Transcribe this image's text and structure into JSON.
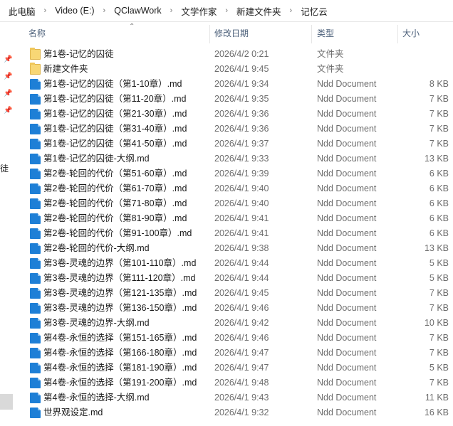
{
  "breadcrumb": {
    "items": [
      "此电脑",
      "Video (E:)",
      "QClawWork",
      "文学作家",
      "新建文件夹",
      "记忆云"
    ],
    "separator": "›"
  },
  "columns": {
    "name": "名称",
    "date": "修改日期",
    "type": "类型",
    "size": "大小"
  },
  "left_panel_cutoff_text": "徒",
  "colors": {
    "file_icon": "#1e7fd6",
    "folder_icon": "#f8d775",
    "header_text": "#4c607a"
  },
  "files": [
    {
      "name": "第1卷-记忆的囚徒",
      "date": "2026/4/2 0:21",
      "type": "文件夹",
      "size": "",
      "kind": "folder"
    },
    {
      "name": "新建文件夹",
      "date": "2026/4/1 9:45",
      "type": "文件夹",
      "size": "",
      "kind": "folder"
    },
    {
      "name": "第1卷-记忆的囚徒（第1-10章）.md",
      "date": "2026/4/1 9:34",
      "type": "Ndd Document",
      "size": "8 KB",
      "kind": "file"
    },
    {
      "name": "第1卷-记忆的囚徒（第11-20章）.md",
      "date": "2026/4/1 9:35",
      "type": "Ndd Document",
      "size": "7 KB",
      "kind": "file"
    },
    {
      "name": "第1卷-记忆的囚徒（第21-30章）.md",
      "date": "2026/4/1 9:36",
      "type": "Ndd Document",
      "size": "7 KB",
      "kind": "file"
    },
    {
      "name": "第1卷-记忆的囚徒（第31-40章）.md",
      "date": "2026/4/1 9:36",
      "type": "Ndd Document",
      "size": "7 KB",
      "kind": "file"
    },
    {
      "name": "第1卷-记忆的囚徒（第41-50章）.md",
      "date": "2026/4/1 9:37",
      "type": "Ndd Document",
      "size": "7 KB",
      "kind": "file"
    },
    {
      "name": "第1卷-记忆的囚徒-大纲.md",
      "date": "2026/4/1 9:33",
      "type": "Ndd Document",
      "size": "13 KB",
      "kind": "file"
    },
    {
      "name": "第2卷-轮回的代价（第51-60章）.md",
      "date": "2026/4/1 9:39",
      "type": "Ndd Document",
      "size": "6 KB",
      "kind": "file"
    },
    {
      "name": "第2卷-轮回的代价（第61-70章）.md",
      "date": "2026/4/1 9:40",
      "type": "Ndd Document",
      "size": "6 KB",
      "kind": "file"
    },
    {
      "name": "第2卷-轮回的代价（第71-80章）.md",
      "date": "2026/4/1 9:40",
      "type": "Ndd Document",
      "size": "6 KB",
      "kind": "file"
    },
    {
      "name": "第2卷-轮回的代价（第81-90章）.md",
      "date": "2026/4/1 9:41",
      "type": "Ndd Document",
      "size": "6 KB",
      "kind": "file"
    },
    {
      "name": "第2卷-轮回的代价（第91-100章）.md",
      "date": "2026/4/1 9:41",
      "type": "Ndd Document",
      "size": "6 KB",
      "kind": "file"
    },
    {
      "name": "第2卷-轮回的代价-大纲.md",
      "date": "2026/4/1 9:38",
      "type": "Ndd Document",
      "size": "13 KB",
      "kind": "file"
    },
    {
      "name": "第3卷-灵魂的边界（第101-110章）.md",
      "date": "2026/4/1 9:44",
      "type": "Ndd Document",
      "size": "5 KB",
      "kind": "file"
    },
    {
      "name": "第3卷-灵魂的边界（第111-120章）.md",
      "date": "2026/4/1 9:44",
      "type": "Ndd Document",
      "size": "5 KB",
      "kind": "file"
    },
    {
      "name": "第3卷-灵魂的边界（第121-135章）.md",
      "date": "2026/4/1 9:45",
      "type": "Ndd Document",
      "size": "7 KB",
      "kind": "file"
    },
    {
      "name": "第3卷-灵魂的边界（第136-150章）.md",
      "date": "2026/4/1 9:46",
      "type": "Ndd Document",
      "size": "7 KB",
      "kind": "file"
    },
    {
      "name": "第3卷-灵魂的边界-大纲.md",
      "date": "2026/4/1 9:42",
      "type": "Ndd Document",
      "size": "10 KB",
      "kind": "file"
    },
    {
      "name": "第4卷-永恒的选择（第151-165章）.md",
      "date": "2026/4/1 9:46",
      "type": "Ndd Document",
      "size": "7 KB",
      "kind": "file"
    },
    {
      "name": "第4卷-永恒的选择（第166-180章）.md",
      "date": "2026/4/1 9:47",
      "type": "Ndd Document",
      "size": "7 KB",
      "kind": "file"
    },
    {
      "name": "第4卷-永恒的选择（第181-190章）.md",
      "date": "2026/4/1 9:47",
      "type": "Ndd Document",
      "size": "5 KB",
      "kind": "file"
    },
    {
      "name": "第4卷-永恒的选择（第191-200章）.md",
      "date": "2026/4/1 9:48",
      "type": "Ndd Document",
      "size": "7 KB",
      "kind": "file"
    },
    {
      "name": "第4卷-永恒的选择-大纲.md",
      "date": "2026/4/1 9:43",
      "type": "Ndd Document",
      "size": "11 KB",
      "kind": "file"
    },
    {
      "name": "世界观设定.md",
      "date": "2026/4/1 9:32",
      "type": "Ndd Document",
      "size": "16 KB",
      "kind": "file"
    }
  ]
}
